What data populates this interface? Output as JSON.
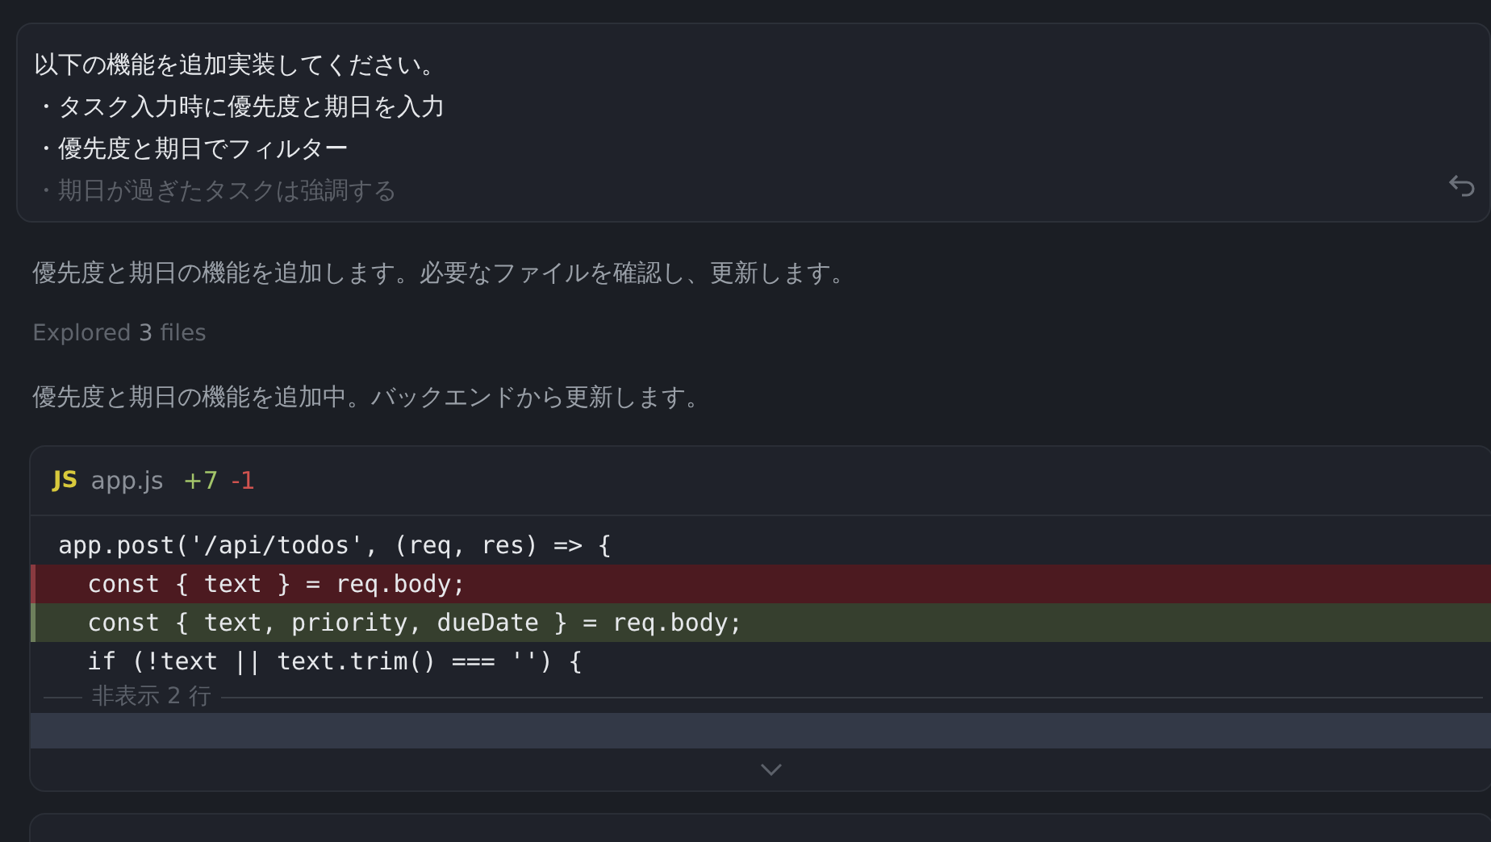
{
  "prompt": {
    "lines": [
      "以下の機能を追加実装してください。",
      "・タスク入力時に優先度と期日を入力",
      "・優先度と期日でフィルター",
      "・期日が過ぎたタスクは強調する"
    ]
  },
  "messages": [
    {
      "kind": "text",
      "text": "優先度と期日の機能を追加します。必要なファイルを確認し、更新します。"
    },
    {
      "kind": "explored",
      "label": "Explored",
      "count": "3",
      "unit": "files"
    },
    {
      "kind": "text",
      "text": "優先度と期日の機能を追加中。バックエンドから更新します。"
    }
  ],
  "diff": {
    "badge": "JS",
    "file": "app.js",
    "added": "+7",
    "removed": "-1",
    "lines": [
      {
        "kind": "context",
        "code": "app.post('/api/todos', (req, res) => {"
      },
      {
        "kind": "removed",
        "code": "  const { text } = req.body;"
      },
      {
        "kind": "added",
        "code": "  const { text, priority, dueDate } = req.body;"
      },
      {
        "kind": "context",
        "code": "  if (!text || text.trim() === '') {"
      }
    ],
    "hidden": "非表示 2 行"
  }
}
